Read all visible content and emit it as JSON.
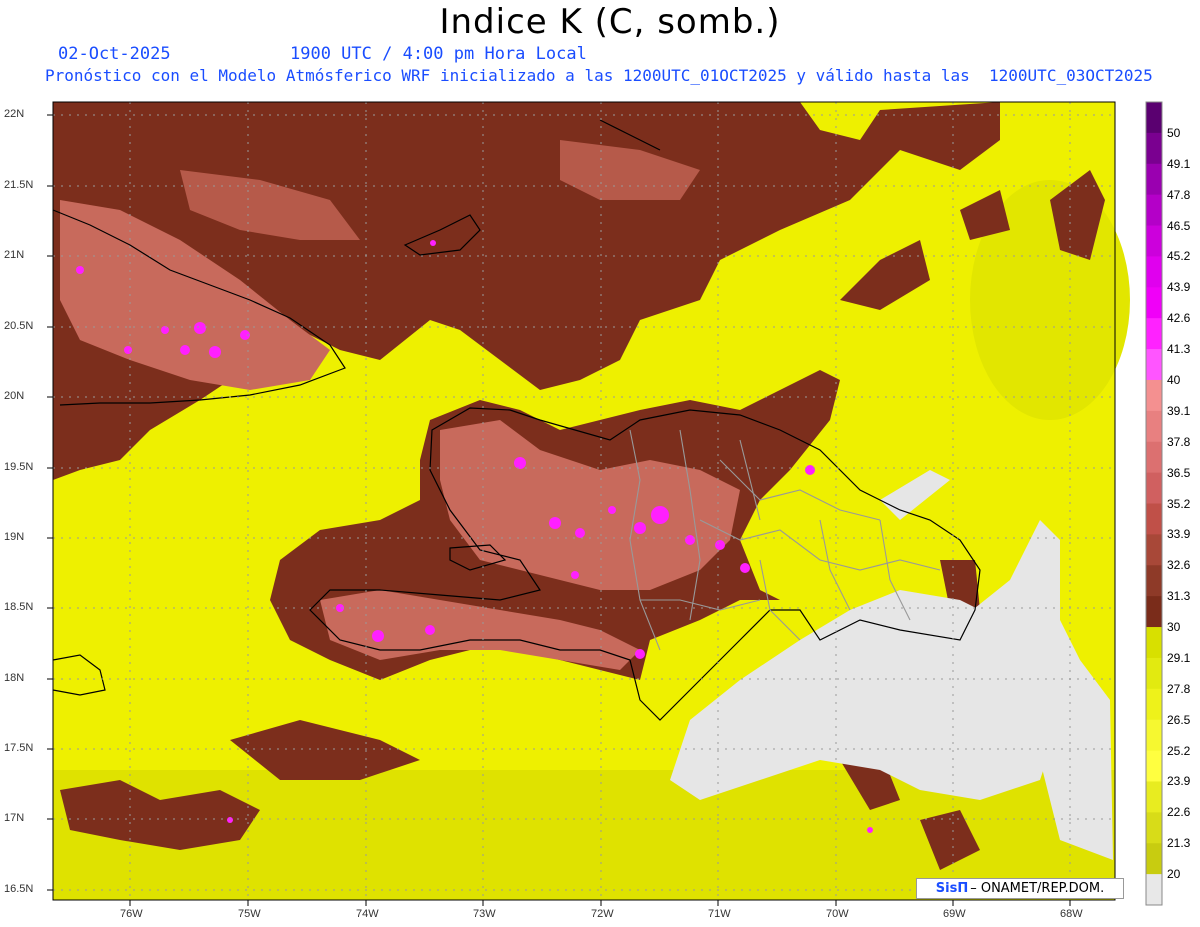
{
  "header": {
    "title": "Indice K (C, somb.)",
    "date": "02-Oct-2025",
    "time": "1900 UTC / 4:00 pm Hora Local",
    "forecast": "Pronóstico con el Modelo Atmósferico WRF inicializado a las 1200UTC_01OCT2025 y válido hasta las  1200UTC_03OCT2025"
  },
  "axes": {
    "lat_labels": [
      "22N",
      "21.5N",
      "21N",
      "20.5N",
      "20N",
      "19.5N",
      "19N",
      "18.5N",
      "18N",
      "17.5N",
      "17N",
      "16.5N"
    ],
    "lon_labels": [
      "76W",
      "75W",
      "74W",
      "73W",
      "72W",
      "71W",
      "70W",
      "69W",
      "68W"
    ]
  },
  "colorbar": {
    "levels": [
      "50",
      "49.1",
      "47.8",
      "46.5",
      "45.2",
      "43.9",
      "42.6",
      "41.3",
      "40",
      "39.1",
      "37.8",
      "36.5",
      "35.2",
      "33.9",
      "32.6",
      "31.3",
      "30",
      "29.1",
      "27.8",
      "26.5",
      "25.2",
      "23.9",
      "22.6",
      "21.3",
      "20"
    ],
    "colors": [
      "#5a0070",
      "#7a0090",
      "#9a00b0",
      "#b400c8",
      "#cc00dc",
      "#e000ee",
      "#f000f8",
      "#ff22ff",
      "#ff55ff",
      "#f49090",
      "#e88080",
      "#dc7070",
      "#d06060",
      "#c05048",
      "#a84838",
      "#8e3a28",
      "#7a2c1a",
      "#d8e000",
      "#e2ea10",
      "#eef21a",
      "#f6f830",
      "#ffff40",
      "#e8ec20",
      "#d8dc18",
      "#c8cc10",
      "#e8e8e8"
    ]
  },
  "palette": {
    "ocean_yellow": "#eef000",
    "ocean_yellow_dark": "#dfe200",
    "land_brown": "#7c2e1c",
    "salmon": "#c86a5c",
    "magenta": "#ff20ff",
    "low_gray": "#e6e6e6",
    "coast": "#000000",
    "border_gray": "#999999",
    "grid": "#9a9a9a"
  },
  "credit": {
    "logo": "SisΠ",
    "text": "– ONAMET/REP.DOM."
  }
}
